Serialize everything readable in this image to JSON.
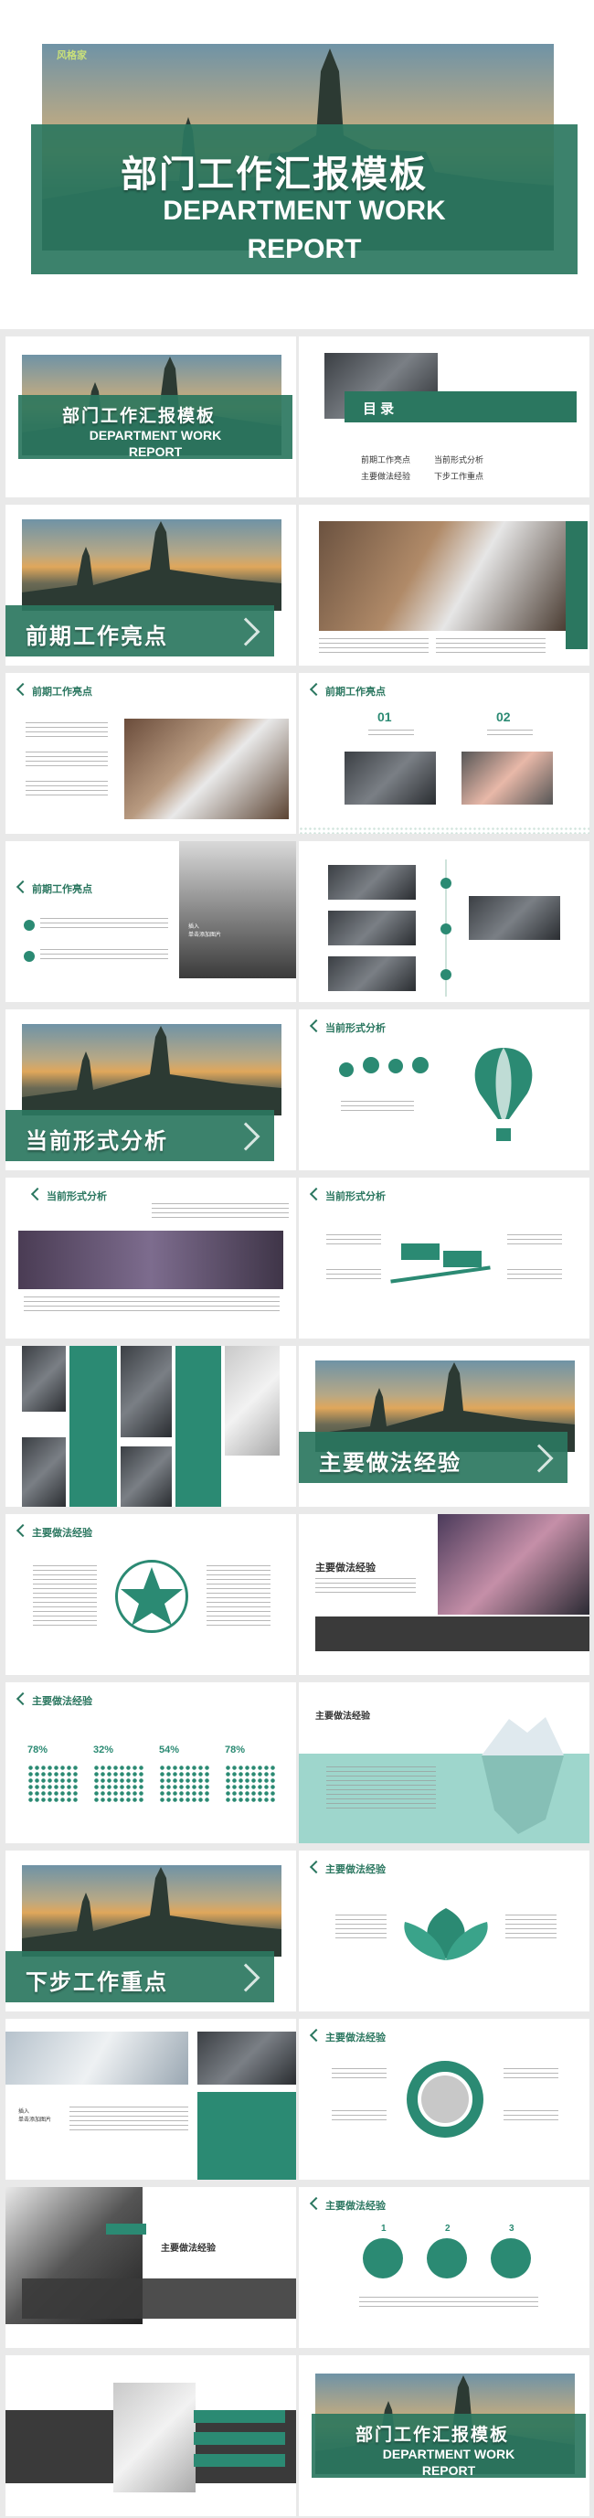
{
  "brand": {
    "logo": "风格家",
    "green": "#2b7760",
    "teal": "#2b8a73"
  },
  "cover": {
    "title_cn": "部门工作汇报模板",
    "title_en_1": "DEPARTMENT WORK",
    "title_en_2": "REPORT"
  },
  "toc": {
    "title": "目 录",
    "items": [
      "前期工作亮点",
      "当前形式分析",
      "主要做法经验",
      "下步工作重点"
    ]
  },
  "sections": {
    "s1": "前期工作亮点",
    "s2": "当前形式分析",
    "s3": "主要做法经验",
    "s4": "下步工作重点"
  },
  "labels": {
    "early_highlight": "前期工作亮点",
    "current_analysis": "当前形式分析",
    "main_experience": "主要做法经验",
    "num_01": "01",
    "num_02": "02",
    "pct": [
      "78%",
      "32%",
      "54%",
      "78%"
    ],
    "insert_image": "插入\n单击添加图片",
    "experience_title": "主要做法经验",
    "step": [
      "1",
      "2",
      "3"
    ]
  }
}
